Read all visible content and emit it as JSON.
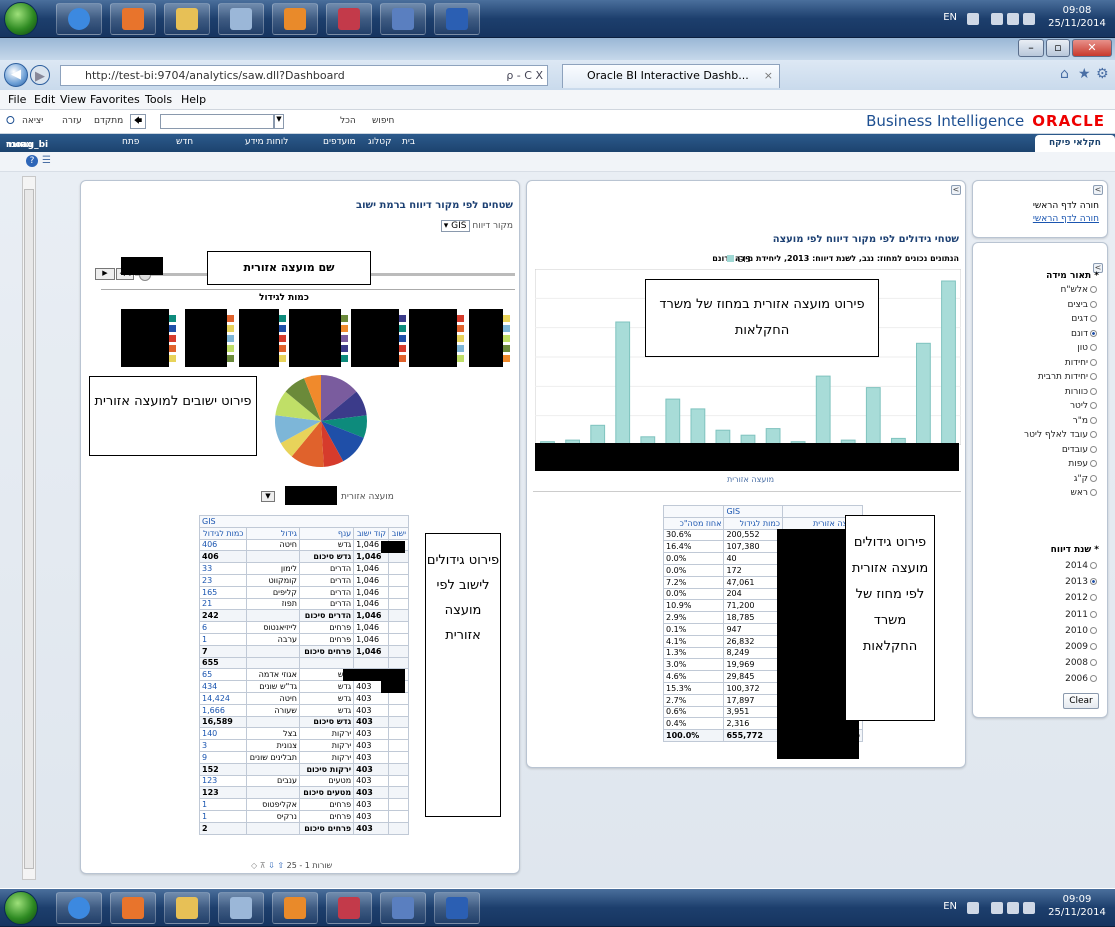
{
  "taskbar": {
    "lang": "EN",
    "time": "09:08",
    "date": "25/11/2014",
    "time2": "09:09",
    "date2": "25/11/2014"
  },
  "browser": {
    "url": "http://test-bi:9704/analytics/saw.dll?Dashboard",
    "tab_title": "Oracle BI Interactive Dashb...",
    "search_hint": "ρ - C X"
  },
  "menu": [
    "File",
    "Edit",
    "View",
    "Favorites",
    "Tools",
    "Help"
  ],
  "obi": {
    "brand": "Business Intelligence",
    "oracle": "ORACLE",
    "search_label": "חיפוש",
    "search_scope": "הכל",
    "advanced": "מתקדם",
    "help": "עזרה",
    "logout": "יציאה"
  },
  "nav": {
    "home": "בית",
    "catalog": "קטלוג",
    "favorites": "מועדפים",
    "dashboards": "לוחות מידע",
    "new": "חדש",
    "open": "פתח",
    "signed_in": "מחובר כ-",
    "user": "moag_bi",
    "tab": "חקלאי פיקח"
  },
  "left_panel": {
    "title": "שטחים לפי מקור דיווח ברמת ישוב",
    "source_label": "מקור דיווח",
    "source_value": "GIS",
    "chart_title": "כמות לגידול",
    "council_label": "מועצה אזורית",
    "callout_name": "שם מועצה אזורית",
    "callout_towns": "פירוט ישובים למועצה אזורית",
    "callout_crops": "פירוט גידולים לישוב לפי מועצה אזורית",
    "pager": "שורות 1 - 25",
    "table": {
      "group": "GIS",
      "headers": [
        "ישוב",
        "קוד ישוב",
        "ענף",
        "גידול",
        "כמות לגידול"
      ],
      "rows": [
        {
          "code": "1,046",
          "branch": "גדש",
          "crop": "חיטה",
          "qty": "406",
          "sum": false
        },
        {
          "code": "1,046",
          "branch": "גדש סיכום",
          "crop": "",
          "qty": "406",
          "sum": true
        },
        {
          "code": "1,046",
          "branch": "הדרים",
          "crop": "לימון",
          "qty": "33",
          "sum": false
        },
        {
          "code": "1,046",
          "branch": "הדרים",
          "crop": "קומקווט",
          "qty": "23",
          "sum": false
        },
        {
          "code": "1,046",
          "branch": "הדרים",
          "crop": "קליפים",
          "qty": "165",
          "sum": false
        },
        {
          "code": "1,046",
          "branch": "הדרים",
          "crop": "תפוז",
          "qty": "21",
          "sum": false
        },
        {
          "code": "1,046",
          "branch": "הדרים סיכום",
          "crop": "",
          "qty": "242",
          "sum": true
        },
        {
          "code": "1,046",
          "branch": "פרחים",
          "crop": "לייזיאנטוס",
          "qty": "6",
          "sum": false
        },
        {
          "code": "1,046",
          "branch": "פרחים",
          "crop": "ערבה",
          "qty": "1",
          "sum": false
        },
        {
          "code": "1,046",
          "branch": "פרחים סיכום",
          "crop": "",
          "qty": "7",
          "sum": true
        },
        {
          "code": "",
          "branch": "",
          "crop": "",
          "qty": "655",
          "sum": true
        },
        {
          "code": "403",
          "branch": "גדש",
          "crop": "אגוזי אדמה",
          "qty": "65",
          "sum": false
        },
        {
          "code": "403",
          "branch": "גדש",
          "crop": "גד\"ש שונים",
          "qty": "434",
          "sum": false
        },
        {
          "code": "403",
          "branch": "גדש",
          "crop": "חיטה",
          "qty": "14,424",
          "sum": false
        },
        {
          "code": "403",
          "branch": "גדש",
          "crop": "שעורה",
          "qty": "1,666",
          "sum": false
        },
        {
          "code": "403",
          "branch": "גדש סיכום",
          "crop": "",
          "qty": "16,589",
          "sum": true
        },
        {
          "code": "403",
          "branch": "ירקות",
          "crop": "בצל",
          "qty": "140",
          "sum": false
        },
        {
          "code": "403",
          "branch": "ירקות",
          "crop": "צנונית",
          "qty": "3",
          "sum": false
        },
        {
          "code": "403",
          "branch": "ירקות",
          "crop": "תבלינים שונים",
          "qty": "9",
          "sum": false
        },
        {
          "code": "403",
          "branch": "ירקות סיכום",
          "crop": "",
          "qty": "152",
          "sum": true
        },
        {
          "code": "403",
          "branch": "מטעים",
          "crop": "ענבים",
          "qty": "123",
          "sum": false
        },
        {
          "code": "403",
          "branch": "מטעים סיכום",
          "crop": "",
          "qty": "123",
          "sum": true
        },
        {
          "code": "403",
          "branch": "פרחים",
          "crop": "אקליפטוס",
          "qty": "1",
          "sum": false
        },
        {
          "code": "403",
          "branch": "פרחים",
          "crop": "נרקיס",
          "qty": "1",
          "sum": false
        },
        {
          "code": "403",
          "branch": "פרחים סיכום",
          "crop": "",
          "qty": "2",
          "sum": true
        }
      ]
    }
  },
  "right_panel": {
    "title": "שטחי גידולים לפי מקור דיווח לפי מועצה",
    "subtitle": "הנתונים נכונים למחוז: נגב, לשנת דיווח: 2013, ליחידת מידה: דונם",
    "legend": "GIS",
    "axis_label": "מועצה אזורית",
    "callout_district": "פירוט מועצה אזורית במחוז של משרד החקלאות",
    "callout_crops": "פירוט גידולים מועצה אזורית לפי מחוז של משרד החקלאות",
    "table": {
      "group": "GIS",
      "headers": [
        "מועצה אזורית",
        "כמות לגידול",
        "אחוז מסה\"כ"
      ],
      "rows": [
        [
          "200,552",
          "30.6%"
        ],
        [
          "107,380",
          "16.4%"
        ],
        [
          "40",
          "0.0%"
        ],
        [
          "172",
          "0.0%"
        ],
        [
          "47,061",
          "7.2%"
        ],
        [
          "204",
          "0.0%"
        ],
        [
          "71,200",
          "10.9%"
        ],
        [
          "18,785",
          "2.9%"
        ],
        [
          "947",
          "0.1%"
        ],
        [
          "26,832",
          "4.1%"
        ],
        [
          "8,249",
          "1.3%"
        ],
        [
          "19,969",
          "3.0%"
        ],
        [
          "29,845",
          "4.6%"
        ],
        [
          "100,372",
          "15.3%"
        ],
        [
          "17,897",
          "2.7%"
        ],
        [
          "3,951",
          "0.6%"
        ],
        [
          "2,316",
          "0.4%"
        ]
      ],
      "total_label": "סיכום כולל",
      "total_qty": "655,772",
      "total_pct": "100.0%"
    }
  },
  "sidebar": {
    "home_label": "חורה לדף הראשי",
    "home_link": "חורה לדף הראשי",
    "measure_title": "* תאור מידה",
    "measures": [
      "אלש\"ח",
      "ביצים",
      "דגים",
      "דונם",
      "טון",
      "יחידות",
      "יחידות תרבית",
      "כוורות",
      "ליטר",
      "מ\"ר",
      "עובד לאלף ליטר",
      "עובדים",
      "עפות",
      "ק\"ג",
      "ראש"
    ],
    "measure_selected": "דונם",
    "year_title": "* שנת דיווח",
    "years": [
      "2014",
      "2013",
      "2012",
      "2011",
      "2010",
      "2009",
      "2008",
      "2006"
    ],
    "year_selected": "2013",
    "clear": "Clear"
  },
  "chart_data": [
    {
      "type": "bar",
      "title": "",
      "legend": [
        "GIS"
      ],
      "xlabel": "מועצה אזורית",
      "values": [
        2,
        3,
        12,
        75,
        5,
        28,
        22,
        9,
        6,
        10,
        2,
        42,
        3,
        35,
        4,
        62,
        100
      ]
    },
    {
      "type": "pie",
      "title": "כמות לגידול",
      "values": [
        14,
        9,
        8,
        11,
        7,
        12,
        6,
        10,
        9,
        8,
        6
      ],
      "colors": [
        "#7a5c9e",
        "#3b3b8a",
        "#0d8b7c",
        "#1f4fa8",
        "#d63b2c",
        "#e0622c",
        "#e8d35a",
        "#7db6d8",
        "#c0df67",
        "#6b8a3a",
        "#f08a2c"
      ]
    }
  ]
}
